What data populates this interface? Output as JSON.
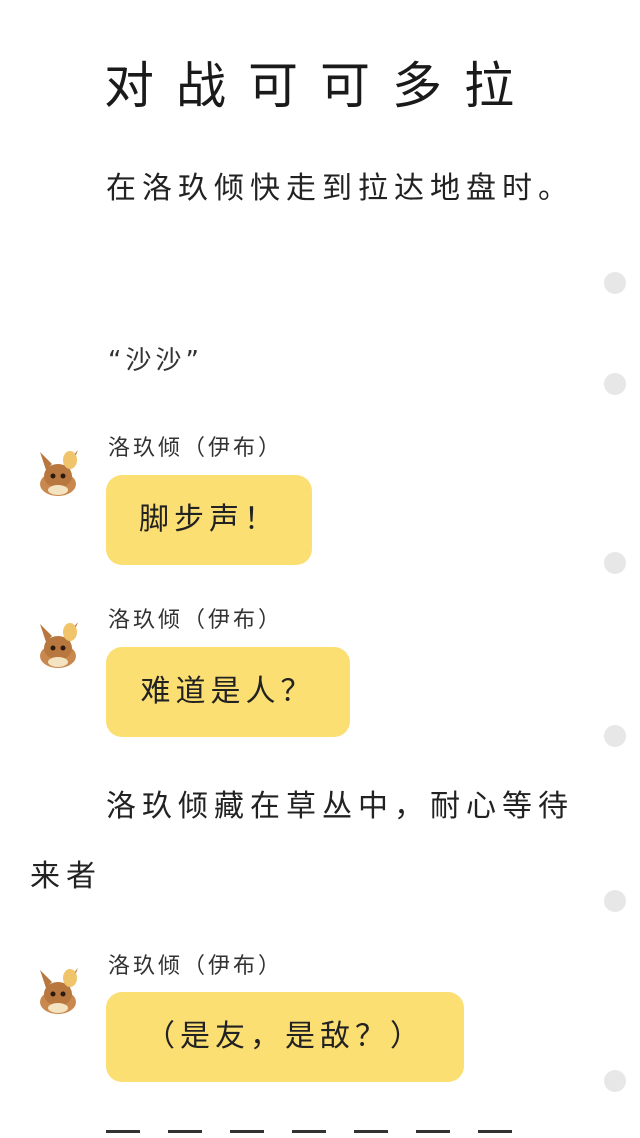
{
  "story": {
    "title": "对战可可多拉",
    "narration_1": "在洛玖倾快走到拉达地盘时。",
    "sound": "“沙沙”",
    "narration_2": "洛玖倾藏在草丛中，耐心等待来者"
  },
  "messages": [
    {
      "speaker": "洛玖倾（伊布）",
      "text": "脚步声！"
    },
    {
      "speaker": "洛玖倾（伊布）",
      "text": "难道是人？"
    },
    {
      "speaker": "洛玖倾（伊布）",
      "text": "（是友，是敌？）"
    }
  ],
  "icons": {
    "avatar": "eevee-avatar-icon",
    "side_dot": "scroll-dot-icon"
  },
  "colors": {
    "bubble": "#fbdf72",
    "dot": "#e7e7e7",
    "text": "#222222"
  }
}
